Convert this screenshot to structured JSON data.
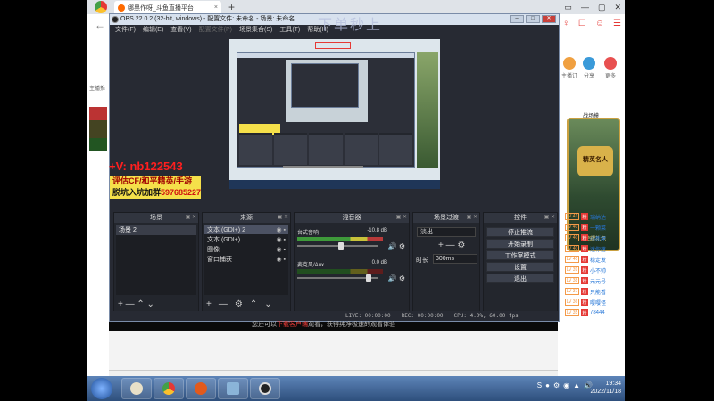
{
  "browser": {
    "tab_title": "哪黑作呀_斗鱼直播平台",
    "tab_close": "×",
    "new_tab": "+",
    "window_buttons": [
      "▭",
      "—",
      "▢",
      "✕"
    ],
    "back": "←",
    "right_icons": [
      "♀",
      "☐",
      "☺",
      "☰"
    ]
  },
  "page_left": {
    "label": "主播推"
  },
  "page_right": {
    "nav": [
      {
        "label": "主播订",
        "color": "#f0a040"
      },
      {
        "label": "分享",
        "color": "#3a9ad9"
      },
      {
        "label": "更多",
        "color": "#e85050"
      }
    ],
    "promo_title": "战场模",
    "promo_crest": "精英名人",
    "promo_slogan": "荣耀礼包",
    "fans": [
      {
        "lv": "LV 41",
        "name": "瑞纳达"
      },
      {
        "lv": "LV 40",
        "name": "一颗菜"
      },
      {
        "lv": "LV 40",
        "name": "小新屋"
      },
      {
        "lv": "LV 40",
        "name": "迷你落"
      },
      {
        "lv": "LV 40",
        "name": "稳定发"
      },
      {
        "lv": "LV 39",
        "name": "小不帅"
      },
      {
        "lv": "LV 38",
        "name": "元元号"
      },
      {
        "lv": "LV 37",
        "name": "只能看"
      },
      {
        "lv": "LV 36",
        "name": "嘤嘤怪"
      },
      {
        "lv": "LV 35",
        "name": "78444"
      }
    ]
  },
  "overlay": {
    "watermark": "下单秒上",
    "red_line": "+V: nb122543",
    "yellow_line1": "评估CF/和平精英/手游",
    "yellow_line2_prefix": "脱坑入坑加群",
    "yellow_line2_num": "597685227"
  },
  "obs": {
    "title": "OBS 22.0.2 (32-bit, windows) - 配置文件: 未命名 - 场景: 未命名",
    "title_buttons": [
      "–",
      "□",
      "✕"
    ],
    "menu": [
      "文件(F)",
      "编辑(E)",
      "查看(V)",
      "配置文件(P)",
      "场景集合(S)",
      "工具(T)",
      "帮助(H)"
    ],
    "docks": {
      "scenes": {
        "title": "场景",
        "items": [
          "场景 2"
        ]
      },
      "sources": {
        "title": "来源",
        "items": [
          {
            "name": "文本 (GDI+) 2",
            "selected": true
          },
          {
            "name": "文本 (GDI+)",
            "selected": false
          },
          {
            "name": "图像",
            "selected": false
          },
          {
            "name": "窗口捕获",
            "selected": false
          }
        ],
        "eye": "👁",
        "lock": "🔒"
      },
      "mixer": {
        "title": "混音器",
        "tracks": [
          {
            "name": "台式音响",
            "db": "-10.8 dB",
            "volume_fraction": 0.55,
            "active": true
          },
          {
            "name": "麦克风/Aux",
            "db": "0.0 dB",
            "volume_fraction": 0.92,
            "active": false
          }
        ]
      },
      "transitions": {
        "title": "场景过渡",
        "selected": "淡出",
        "duration_label": "时长",
        "duration": "300ms",
        "plus": "+ — ⚙"
      },
      "controls": {
        "title": "控件",
        "buttons": [
          "停止推流",
          "开始录制",
          "工作室模式",
          "设置",
          "退出"
        ]
      }
    },
    "dock_footer": "+ — ⌃ ⌄",
    "status": {
      "live": "LIVE: 00:00:00",
      "rec": "REC: 00:00:00",
      "cpu": "CPU: 4.0%, 60.00 fps"
    }
  },
  "caption": {
    "prefix": "您还可以",
    "highlight": "下载客户端",
    "suffix": "观看，获得纯净极速的观看体验"
  },
  "taskbar": {
    "tray": [
      "S",
      "●",
      "⚙",
      "◉",
      "▲",
      "🔊"
    ],
    "time": "19:34",
    "date": "2022/11/18"
  }
}
